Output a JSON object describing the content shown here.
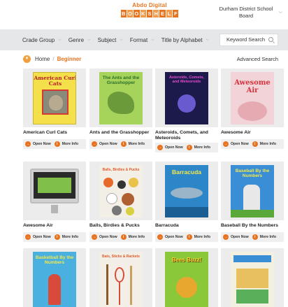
{
  "header": {
    "logo_top": "Abdo Digital",
    "logo_letters": [
      "B",
      "O",
      "O",
      "K",
      "S",
      "H",
      "E",
      "L",
      "F"
    ],
    "district": "Durham District School Board",
    "brand_color": "#e8731f"
  },
  "nav": {
    "items": [
      {
        "label": "Crade Group"
      },
      {
        "label": "Genre"
      },
      {
        "label": "Subject"
      },
      {
        "label": "Format"
      },
      {
        "label": "Title by Alphabet"
      }
    ],
    "search_placeholder": "Keyword Search"
  },
  "breadcrumb": {
    "home": "Home",
    "separator": "/",
    "current": "Beginner",
    "advanced": "Advanced Search"
  },
  "actions": {
    "open": "Open Now",
    "more": "More Info"
  },
  "books": [
    {
      "title": "American Curl Cats",
      "cover_text": "American Curl Cats"
    },
    {
      "title": "Ants and the Grasshopper",
      "cover_text": "The Ants and the Grasshopper"
    },
    {
      "title": "Asteroids, Comets, and Meteoroids",
      "cover_text": "Asteroids, Comets, and Meteoroids"
    },
    {
      "title": "Awesome Air",
      "cover_text": "Awesome Air"
    },
    {
      "title": "Awesome Air",
      "cover_text": ""
    },
    {
      "title": "Balls, Birdies & Pucks",
      "cover_text": "Balls, Birdies & Pucks"
    },
    {
      "title": "Barracuda",
      "cover_text": "Barracuda"
    },
    {
      "title": "Baseball By the Numbers",
      "cover_text": "Baseball By the Numbers"
    },
    {
      "title": "",
      "cover_text": "Basketball By the Numbers"
    },
    {
      "title": "",
      "cover_text": "Bats, Sticks & Rackets"
    },
    {
      "title": "",
      "cover_text": "Bees Buzz!"
    },
    {
      "title": "",
      "cover_text": ""
    }
  ]
}
